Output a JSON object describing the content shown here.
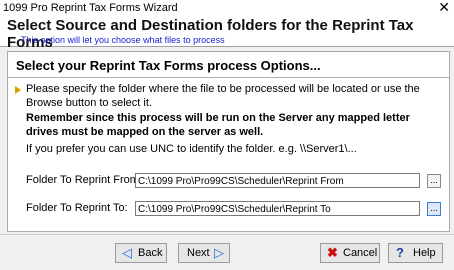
{
  "window": {
    "title": "1099 Pro Reprint Tax Forms Wizard",
    "close_glyph": "✕"
  },
  "header": {
    "title": "Select Source and Destination folders for the Reprint Tax Forms",
    "subtitle": "This option will let you choose what files to process"
  },
  "panel": {
    "title": "Select your Reprint Tax Forms process Options...",
    "instruction": "Please specify the folder where the file to be processed will be located or use the Browse button to select it.",
    "warning": "Remember since this process will be run on the Server any mapped letter drives must be mapped on the server as well.",
    "unc_note": "If you prefer you can use UNC to identify the folder. e.g. \\\\Server1\\..."
  },
  "fields": {
    "from": {
      "label": "Folder To Reprint From:",
      "value": "C:\\1099 Pro\\Pro99CS\\Scheduler\\Reprint From",
      "browse": "..."
    },
    "to": {
      "label": "Folder To Reprint To:",
      "value": "C:\\1099 Pro\\Pro99CS\\Scheduler\\Reprint To",
      "browse": "..."
    }
  },
  "buttons": {
    "back": "Back",
    "next": "Next",
    "cancel": "Cancel",
    "help": "Help"
  },
  "colors": {
    "subtitle": "#1a1ad0",
    "arrow": "#d9a000"
  }
}
